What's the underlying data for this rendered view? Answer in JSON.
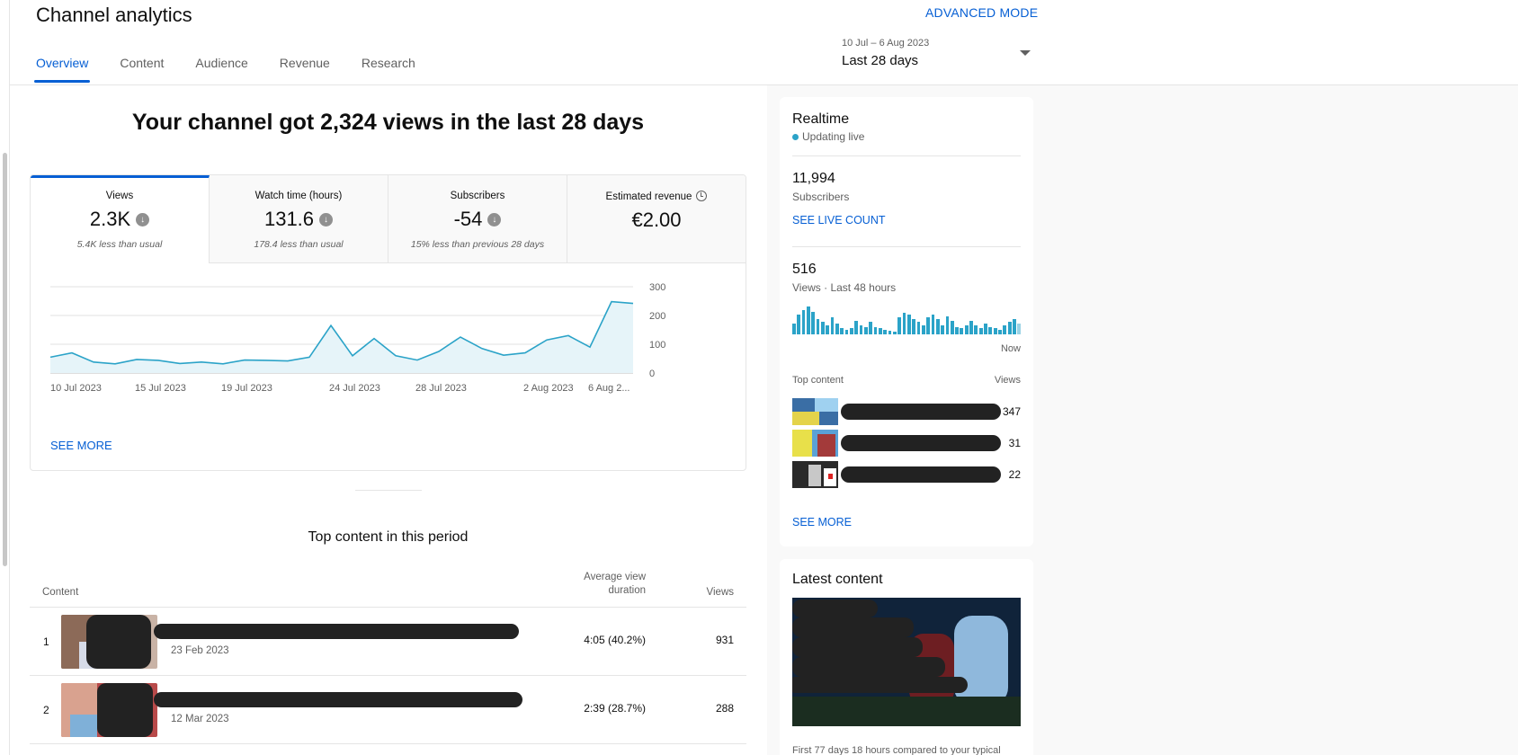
{
  "header": {
    "title": "Channel analytics",
    "advanced_mode": "ADVANCED MODE",
    "tabs": [
      {
        "label": "Overview",
        "active": true
      },
      {
        "label": "Content",
        "active": false
      },
      {
        "label": "Audience",
        "active": false
      },
      {
        "label": "Revenue",
        "active": false
      },
      {
        "label": "Research",
        "active": false
      }
    ],
    "date_range": "10 Jul – 6 Aug 2023",
    "date_label": "Last 28 days"
  },
  "overview": {
    "headline": "Your channel got 2,324 views in the last 28 days",
    "metrics": [
      {
        "label": "Views",
        "value": "2.3K",
        "sub": "5.4K less than usual",
        "icon": "arrow-down-icon"
      },
      {
        "label": "Watch time (hours)",
        "value": "131.6",
        "sub": "178.4 less than usual",
        "icon": "arrow-down-icon"
      },
      {
        "label": "Subscribers",
        "value": "-54",
        "sub": "15% less than previous 28 days",
        "icon": "arrow-down-icon"
      },
      {
        "label": "Estimated revenue",
        "value": "€2.00",
        "sub": "",
        "icon": "clock-icon"
      }
    ],
    "see_more": "SEE MORE"
  },
  "chart_data": {
    "type": "area",
    "title": "",
    "xlabel": "",
    "ylabel": "",
    "ylim": [
      0,
      300
    ],
    "yticks": [
      0,
      100,
      200,
      300
    ],
    "x_tick_labels": [
      "10 Jul 2023",
      "15 Jul 2023",
      "19 Jul 2023",
      "24 Jul 2023",
      "28 Jul 2023",
      "2 Aug 2023",
      "6 Aug 2..."
    ],
    "x_tick_index": [
      0,
      5,
      9,
      14,
      18,
      23,
      26
    ],
    "x": [
      "10 Jul",
      "11 Jul",
      "12 Jul",
      "13 Jul",
      "14 Jul",
      "15 Jul",
      "16 Jul",
      "17 Jul",
      "18 Jul",
      "19 Jul",
      "20 Jul",
      "21 Jul",
      "22 Jul",
      "23 Jul",
      "24 Jul",
      "25 Jul",
      "26 Jul",
      "27 Jul",
      "28 Jul",
      "29 Jul",
      "30 Jul",
      "31 Jul",
      "1 Aug",
      "2 Aug",
      "3 Aug",
      "4 Aug",
      "5 Aug",
      "6 Aug"
    ],
    "series": [
      {
        "values": [
          55,
          70,
          38,
          32,
          47,
          44,
          33,
          38,
          32,
          45,
          44,
          42,
          55,
          165,
          60,
          120,
          60,
          45,
          75,
          125,
          85,
          62,
          70,
          115,
          130,
          90,
          248,
          242
        ]
      }
    ],
    "grid": true,
    "color": "#2ba3c8"
  },
  "top_content": {
    "title": "Top content in this period",
    "headers": {
      "content": "Content",
      "avd": "Average view duration",
      "views": "Views"
    },
    "rows": [
      {
        "index": "1",
        "date": "23 Feb 2023",
        "avd": "4:05  (40.2%)",
        "views": "931"
      },
      {
        "index": "2",
        "date": "12 Mar 2023",
        "avd": "2:39  (28.7%)",
        "views": "288"
      }
    ]
  },
  "realtime": {
    "title": "Realtime",
    "status": "Updating live",
    "subscribers": "11,994",
    "subscribers_label": "Subscribers",
    "see_live_count": "SEE LIVE COUNT",
    "views": "516",
    "views_label": "Views · Last 48 hours",
    "now_label": "Now",
    "bars": [
      0.35,
      0.65,
      0.8,
      0.9,
      0.75,
      0.5,
      0.4,
      0.3,
      0.55,
      0.35,
      0.2,
      0.15,
      0.2,
      0.45,
      0.3,
      0.25,
      0.4,
      0.25,
      0.2,
      0.15,
      0.12,
      0.1,
      0.55,
      0.7,
      0.65,
      0.5,
      0.4,
      0.3,
      0.55,
      0.65,
      0.5,
      0.3,
      0.6,
      0.45,
      0.25,
      0.2,
      0.3,
      0.45,
      0.3,
      0.2,
      0.35,
      0.25,
      0.2,
      0.15,
      0.3,
      0.4,
      0.5,
      0.35
    ],
    "top_content_label": "Top content",
    "views_col": "Views",
    "top_items": [
      {
        "views": "347"
      },
      {
        "views": "31"
      },
      {
        "views": "22"
      }
    ],
    "see_more": "SEE MORE"
  },
  "latest": {
    "title": "Latest content",
    "note": "First 77 days 18 hours compared to your typical"
  }
}
